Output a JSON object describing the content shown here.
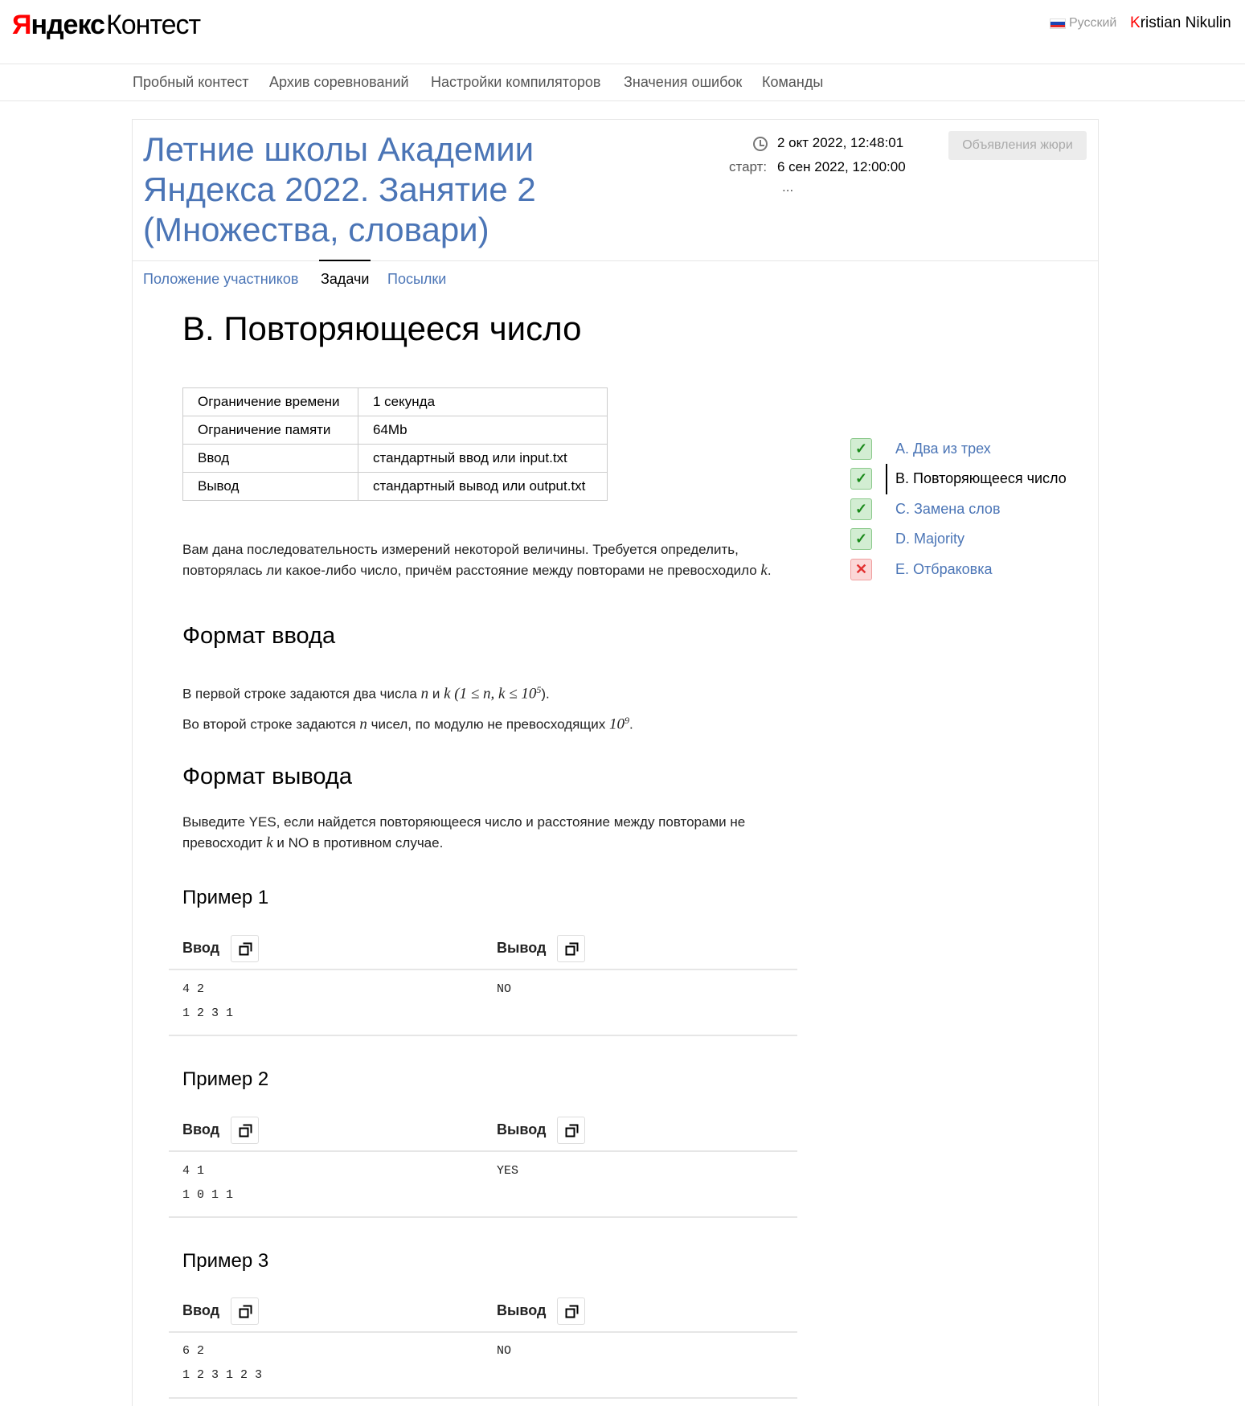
{
  "header": {
    "logo_ya": "Я",
    "logo_ya_rest": "ндекс",
    "logo_product": "Контест",
    "language": "Русский",
    "user_first_letter": "K",
    "user_rest": "ristian Nikulin"
  },
  "nav": [
    "Пробный контест",
    "Архив соревнований",
    "Настройки компиляторов",
    "Значения ошибок",
    "Команды"
  ],
  "contest": {
    "title": "Летние школы Академии Яндекса 2022. Занятие 2 (Множества, словари)",
    "current_time": "2 окт 2022, 12:48:01",
    "start_label": "старт:",
    "start_time": "6 сен 2022, 12:00:00",
    "ellipsis": "...",
    "jury_button": "Объявления жюри",
    "tabs": [
      "Положение участников",
      "Задачи",
      "Посылки"
    ],
    "active_tab": "Задачи"
  },
  "problem": {
    "title": "B. Повторяющееся число",
    "limits": [
      {
        "label": "Ограничение времени",
        "value": "1 секунда"
      },
      {
        "label": "Ограничение памяти",
        "value": "64Mb"
      },
      {
        "label": "Ввод",
        "value": "стандартный ввод или input.txt"
      },
      {
        "label": "Вывод",
        "value": "стандартный вывод или output.txt"
      }
    ],
    "statement_line1": "Вам дана последовательность измерений некоторой величины. Требуется определить,",
    "statement_line2_pre": "повторялась ли какое-либо число, причём расстояние между повторами не превосходило ",
    "statement_line2_var": "k",
    "statement_line2_post": ".",
    "input_heading": "Формат ввода",
    "input_line1_pre": "В первой строке задаются два числа ",
    "input_line1_n": "n",
    "input_line1_and": " и ",
    "input_line1_k": "k",
    "input_line1_math": " (1 ≤ n, k ≤ 10",
    "input_line1_exp": "5",
    "input_line1_post": ").",
    "input_line2_pre": "Во второй строке задаются ",
    "input_line2_n": "n",
    "input_line2_mid": " чисел, по модулю не превосходящих ",
    "input_line2_math": "10",
    "input_line2_exp": "9",
    "input_line2_post": ".",
    "output_heading": "Формат вывода",
    "output_line1": "Выведите YES, если найдется повторяющееся число и расстояние между повторами не",
    "output_line2_pre": "превосходит ",
    "output_line2_var": "k",
    "output_line2_post": " и NO в противном случае.",
    "input_label": "Ввод",
    "output_label": "Вывод",
    "examples": [
      {
        "title": "Пример 1",
        "input": "4 2\n1 2 3 1",
        "output": "NO"
      },
      {
        "title": "Пример 2",
        "input": "4 1\n1 0 1 1",
        "output": "YES"
      },
      {
        "title": "Пример 3",
        "input": "6 2\n1 2 3 1 2 3",
        "output": "NO"
      }
    ]
  },
  "problem_list": [
    {
      "label": "A. Два из трех",
      "status": "ok",
      "active": false
    },
    {
      "label": "B. Повторяющееся число",
      "status": "ok",
      "active": true
    },
    {
      "label": "C. Замена слов",
      "status": "ok",
      "active": false
    },
    {
      "label": "D. Majority",
      "status": "ok",
      "active": false
    },
    {
      "label": "E. Отбраковка",
      "status": "fail",
      "active": false
    }
  ],
  "colors": {
    "link": "#4b75b6",
    "brand_red": "#ff0000",
    "ok_bg": "#d2edd2",
    "fail_bg": "#fbd7d7"
  },
  "icons": {
    "ok": "check-icon",
    "fail": "cross-icon",
    "copy": "copy-icon",
    "clock": "clock-icon",
    "flag": "russian-flag-icon"
  }
}
